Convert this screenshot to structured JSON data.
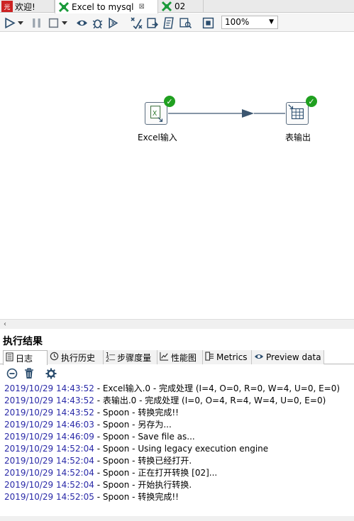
{
  "tabs": [
    {
      "label": "欢迎!",
      "icon": "welcome-icon"
    },
    {
      "label": "Excel to mysql",
      "icon": "transformation-icon",
      "close": "⊠"
    },
    {
      "label": "02",
      "icon": "transformation-icon"
    }
  ],
  "toolbar": {
    "zoom_value": "100%",
    "icons": [
      "run-icon",
      "run-dropdown-icon",
      "pause-icon",
      "stop-icon",
      "stop-dropdown-icon",
      "preview-icon",
      "debug-icon",
      "replay-icon",
      "verify-icon",
      "impact-icon",
      "sql-icon",
      "explore-db-icon",
      "show-results-icon"
    ]
  },
  "canvas": {
    "nodes": [
      {
        "label": "Excel输入",
        "icon": "excel-input-icon",
        "status": "success"
      },
      {
        "label": "表输出",
        "icon": "table-output-icon",
        "status": "success"
      }
    ]
  },
  "results": {
    "title": "执行结果",
    "tabs": [
      {
        "label": "日志",
        "icon": "log-icon"
      },
      {
        "label": "执行历史",
        "icon": "history-icon"
      },
      {
        "label": "步骤度量",
        "icon": "step-metrics-icon"
      },
      {
        "label": "性能图",
        "icon": "performance-graph-icon"
      },
      {
        "label": "Metrics",
        "icon": "metrics-icon"
      },
      {
        "label": "Preview data",
        "icon": "preview-data-icon"
      }
    ],
    "toolbar_icons": [
      "stop-log-icon",
      "clear-log-icon",
      "log-settings-icon"
    ],
    "log": [
      {
        "ts": "2019/10/29 14:43:52",
        "msg": " - Excel输入.0 - 完成处理 (I=4, O=0, R=0, W=4, U=0, E=0)"
      },
      {
        "ts": "2019/10/29 14:43:52",
        "msg": " - 表输出.0 - 完成处理 (I=0, O=4, R=4, W=4, U=0, E=0)"
      },
      {
        "ts": "2019/10/29 14:43:52",
        "msg": " - Spoon - 转换完成!!"
      },
      {
        "ts": "2019/10/29 14:46:03",
        "msg": " - Spoon - 另存为..."
      },
      {
        "ts": "2019/10/29 14:46:09",
        "msg": " - Spoon - Save file as..."
      },
      {
        "ts": "2019/10/29 14:52:04",
        "msg": " - Spoon - Using legacy execution engine"
      },
      {
        "ts": "2019/10/29 14:52:04",
        "msg": " - Spoon - 转换已经打开."
      },
      {
        "ts": "2019/10/29 14:52:04",
        "msg": " - Spoon - 正在打开转换 [02]..."
      },
      {
        "ts": "2019/10/29 14:52:04",
        "msg": " - Spoon - 开始执行转换."
      },
      {
        "ts": "2019/10/29 14:52:05",
        "msg": " - Spoon - 转换完成!!"
      }
    ]
  }
}
